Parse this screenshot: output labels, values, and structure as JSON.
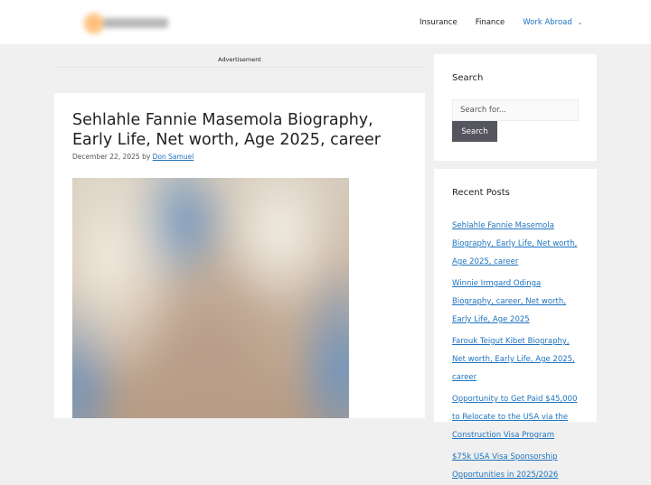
{
  "header": {
    "nav": [
      {
        "label": "Insurance",
        "active": false
      },
      {
        "label": "Finance",
        "active": false
      },
      {
        "label": "Work Abroad",
        "active": true,
        "has_dropdown": true
      }
    ]
  },
  "ad": {
    "label": "Advertisement"
  },
  "article": {
    "title": "Sehlahle Fannie Masemola Biography, Early Life, Net worth, Age 2025, career",
    "date": "December 22, 2025",
    "by": "by",
    "author": "Don Samuel"
  },
  "sidebar": {
    "search": {
      "title": "Search",
      "placeholder": "Search for...",
      "button_label": "Search"
    },
    "recent": {
      "title": "Recent Posts",
      "posts": [
        "Sehlahle Fannie Masemola Biography, Early Life, Net worth, Age 2025, career",
        "Winnie Irmgard Odinga Biography, career, Net worth, Early Life, Age 2025",
        "Farouk Teigut Kibet Biography, Net worth, Early Life, Age 2025, career",
        "Opportunity to Get Paid $45,000 to Relocate to the USA via the Construction Visa Program",
        "$75k USA Visa Sponsorship Opportunities in 2025/2026"
      ]
    }
  },
  "colors": {
    "link": "#1e73be",
    "button": "#55555e",
    "page_bg": "#f0f0f0"
  },
  "icons": {
    "nav_dropdown": "chevron-down-icon"
  }
}
